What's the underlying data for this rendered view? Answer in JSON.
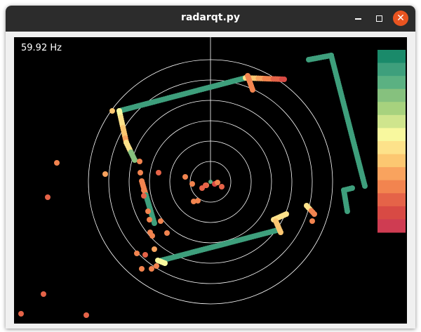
{
  "window": {
    "title": "radarqt.py"
  },
  "controls": {
    "minimize_icon": "minimize-icon",
    "maximize_icon": "maximize-icon",
    "close_icon": "close-icon",
    "close_color": "#e95420"
  },
  "canvas": {
    "background": "#000000",
    "fps_label": "59.92 Hz",
    "range_rings": 6,
    "ring_color": "#ffffff"
  },
  "colorbar": {
    "colors": [
      "#1a8a6a",
      "#3e9f7c",
      "#5bb182",
      "#86c17e",
      "#a7d27e",
      "#cfe58d",
      "#f8f89e",
      "#fde28a",
      "#fcc771",
      "#f9a35e",
      "#f2844f",
      "#e56348",
      "#d84a44",
      "#cf3c52"
    ]
  }
}
